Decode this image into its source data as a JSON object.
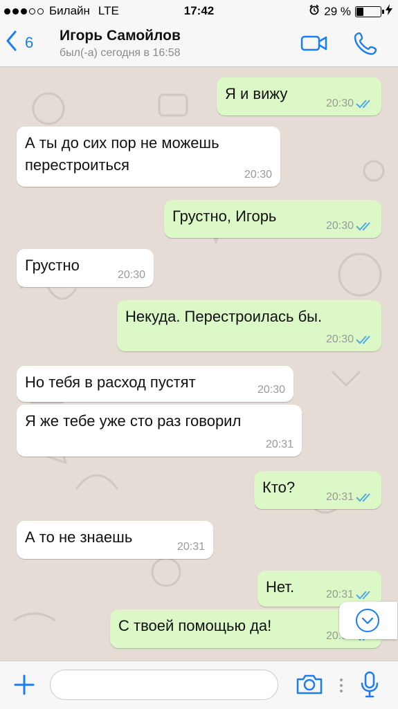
{
  "status_bar": {
    "carrier": "Билайн",
    "network": "LTE",
    "time": "17:42",
    "battery": "29 %",
    "battery_level": 0.29,
    "signal_bars_filled": 3,
    "signal_bars_total": 5
  },
  "header": {
    "back_count": "6",
    "contact_name": "Игорь Самойлов",
    "contact_status": "был(-а) сегодня в 16:58"
  },
  "messages": [
    {
      "direction": "out",
      "text": "Я и вижу",
      "time": "20:30",
      "read": true
    },
    {
      "direction": "in",
      "text": "А ты до сих пор  не можешь перестроиться",
      "time": "20:30"
    },
    {
      "direction": "out",
      "text": "Грустно, Игорь",
      "time": "20:30",
      "read": true
    },
    {
      "direction": "in",
      "text": "Грустно",
      "time": "20:30"
    },
    {
      "direction": "out",
      "text": "Некуда. Перестроилась бы.",
      "time": "20:30",
      "read": true
    },
    {
      "direction": "in",
      "text": "Но тебя в расход пустят",
      "time": "20:30"
    },
    {
      "direction": "in",
      "text": "Я же тебе уже сто раз говорил",
      "time": "20:31"
    },
    {
      "direction": "out",
      "text": "Кто?",
      "time": "20:31",
      "read": true
    },
    {
      "direction": "in",
      "text": "А то не знаешь",
      "time": "20:31"
    },
    {
      "direction": "out",
      "text": "Нет.",
      "time": "20:31",
      "read": true
    },
    {
      "direction": "out",
      "text": "С твоей помощью да!",
      "time": "20:31",
      "read": true
    }
  ],
  "input": {
    "placeholder": "",
    "value": ""
  },
  "icons": {
    "back": "chevron-left-icon",
    "video_call": "video-camera-icon",
    "voice_call": "phone-icon",
    "attach": "plus-icon",
    "camera": "camera-icon",
    "more": "ellipsis-vertical-icon",
    "microphone": "microphone-icon",
    "scroll_down": "chevron-down-circle-icon",
    "read_receipt": "double-check-icon"
  },
  "colors": {
    "accent": "#1a7cf6",
    "outgoing_bubble": "#dcf8c6",
    "incoming_bubble": "#ffffff",
    "read_ticks": "#4fa8e8",
    "chat_background": "#e5ddd5"
  }
}
